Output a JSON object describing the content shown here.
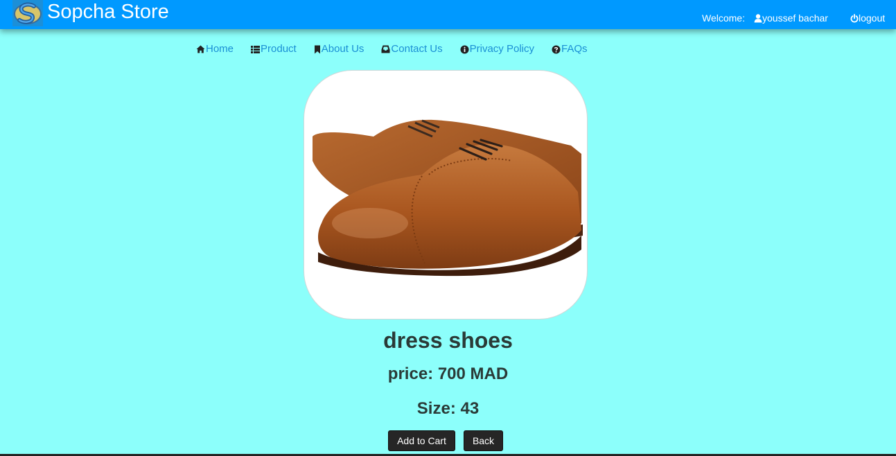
{
  "header": {
    "brand": "Sopcha Store",
    "welcome_label": "Welcome:",
    "username": "youssef bachar",
    "logout_label": "logout",
    "user_icon": "user-icon",
    "logout_icon": "power-icon"
  },
  "nav": {
    "items": [
      {
        "label": "Home",
        "icon": "home-icon"
      },
      {
        "label": "Product",
        "icon": "list-icon"
      },
      {
        "label": "About Us",
        "icon": "bookmark-icon"
      },
      {
        "label": "Contact Us",
        "icon": "inbox-icon"
      },
      {
        "label": "Privacy Policy",
        "icon": "info-icon"
      },
      {
        "label": "FAQs",
        "icon": "question-icon"
      }
    ]
  },
  "product": {
    "name": "dress shoes",
    "price_text": "price: 700 MAD",
    "size_text": "Size: 43"
  },
  "actions": {
    "add_to_cart": "Add to Cart",
    "back": "Back"
  },
  "colors": {
    "header_bg": "#0099ff",
    "page_bg": "#8cfffb",
    "nav_link": "#1a8fd4",
    "button_bg": "#262626"
  }
}
